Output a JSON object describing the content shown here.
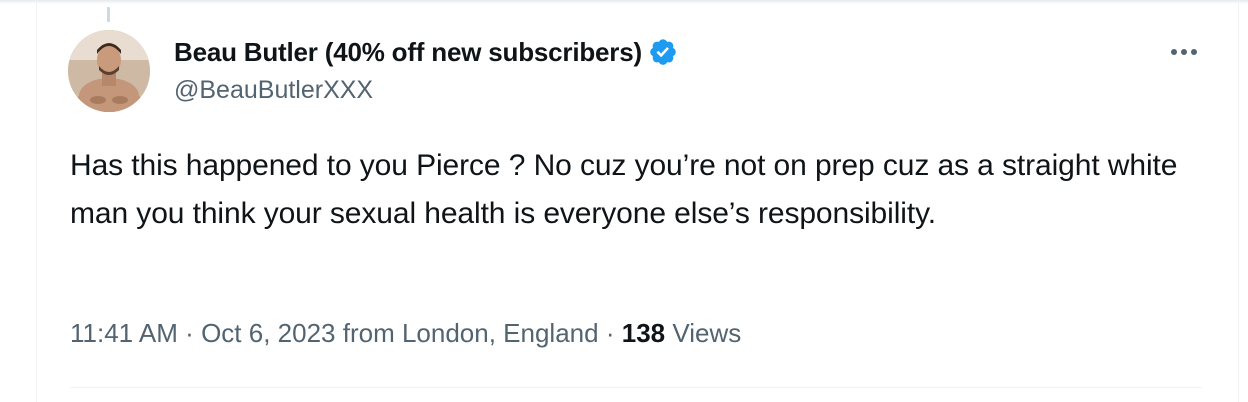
{
  "tweet": {
    "author": {
      "display_name": "Beau Butler (40% off new subscribers)",
      "handle": "@BeauButlerXXX",
      "verified": true,
      "verified_color": "#1d9bf0"
    },
    "text": "Has this happened to you Pierce ? No cuz you’re not on prep cuz as a straight white man you think your sexual health is everyone else’s responsibility.",
    "time": "11:41 AM",
    "separator": "·",
    "date": "Oct 6, 2023",
    "location": "from London, England",
    "views_count": "138",
    "views_label": "Views"
  },
  "icons": {
    "more": "more-dots-icon",
    "verified": "verified-badge-icon"
  },
  "colors": {
    "text_primary": "#0f1419",
    "text_secondary": "#536471",
    "border": "#eff3f4",
    "accent": "#1d9bf0"
  }
}
